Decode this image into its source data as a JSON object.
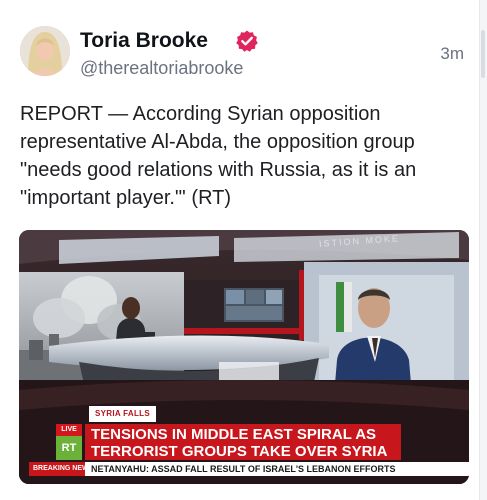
{
  "post": {
    "author_name": "Toria Brooke",
    "handle": "@therealtoriabrooke",
    "timestamp": "3m",
    "text": "REPORT — According Syrian opposition\nrepresentative Al-Abda, the opposition group\n\"needs good relations with Russia, as it is an\n\"important player.\"' (RT)",
    "verified_icon": "verified-badge-icon",
    "verified_color": "#e0245e"
  },
  "media": {
    "studio_sign": "ISTION MOKE",
    "chyron_tag": "SYRIA FALLS",
    "live_label": "LIVE",
    "channel_logo": "RT",
    "headline_line1": "TENSIONS IN MIDDLE EAST SPIRAL AS",
    "headline_line2": "TERRORIST GROUPS TAKE OVER SYRIA",
    "breaking_label": "BREAKING NEWS",
    "ticker_text": "NETANYAHU: ASSAD FALL RESULT OF ISRAEL'S LEBANON EFFORTS",
    "brand_red": "#c8161d",
    "logo_green": "#6cb23a"
  }
}
